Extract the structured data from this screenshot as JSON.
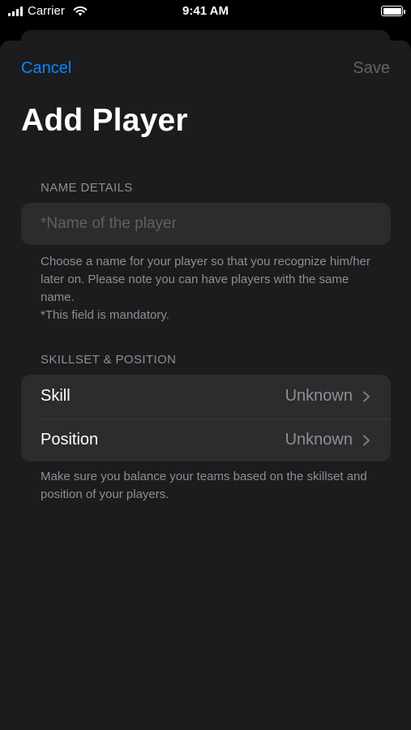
{
  "status_bar": {
    "carrier": "Carrier",
    "time": "9:41 AM"
  },
  "nav": {
    "cancel_label": "Cancel",
    "save_label": "Save"
  },
  "title": "Add Player",
  "name_section": {
    "header": "NAME DETAILS",
    "input_placeholder": "*Name of the player",
    "input_value": "",
    "footer": "Choose a name for your player so that you recognize him/her later on. Please note you can have players with the same name.\n*This field is mandatory."
  },
  "skill_section": {
    "header": "SKILLSET & POSITION",
    "rows": [
      {
        "label": "Skill",
        "value": "Unknown"
      },
      {
        "label": "Position",
        "value": "Unknown"
      }
    ],
    "footer": "Make sure you balance your teams based on the skillset and position of your players."
  },
  "colors": {
    "accent": "#0a84ff",
    "background": "#1c1c1e",
    "grouped_cell": "#2c2c2e",
    "secondary_text": "#8e8e93",
    "disabled_text": "#636366"
  },
  "icons": [
    "cellular-signal-icon",
    "wifi-icon",
    "battery-icon",
    "chevron-right-icon"
  ]
}
